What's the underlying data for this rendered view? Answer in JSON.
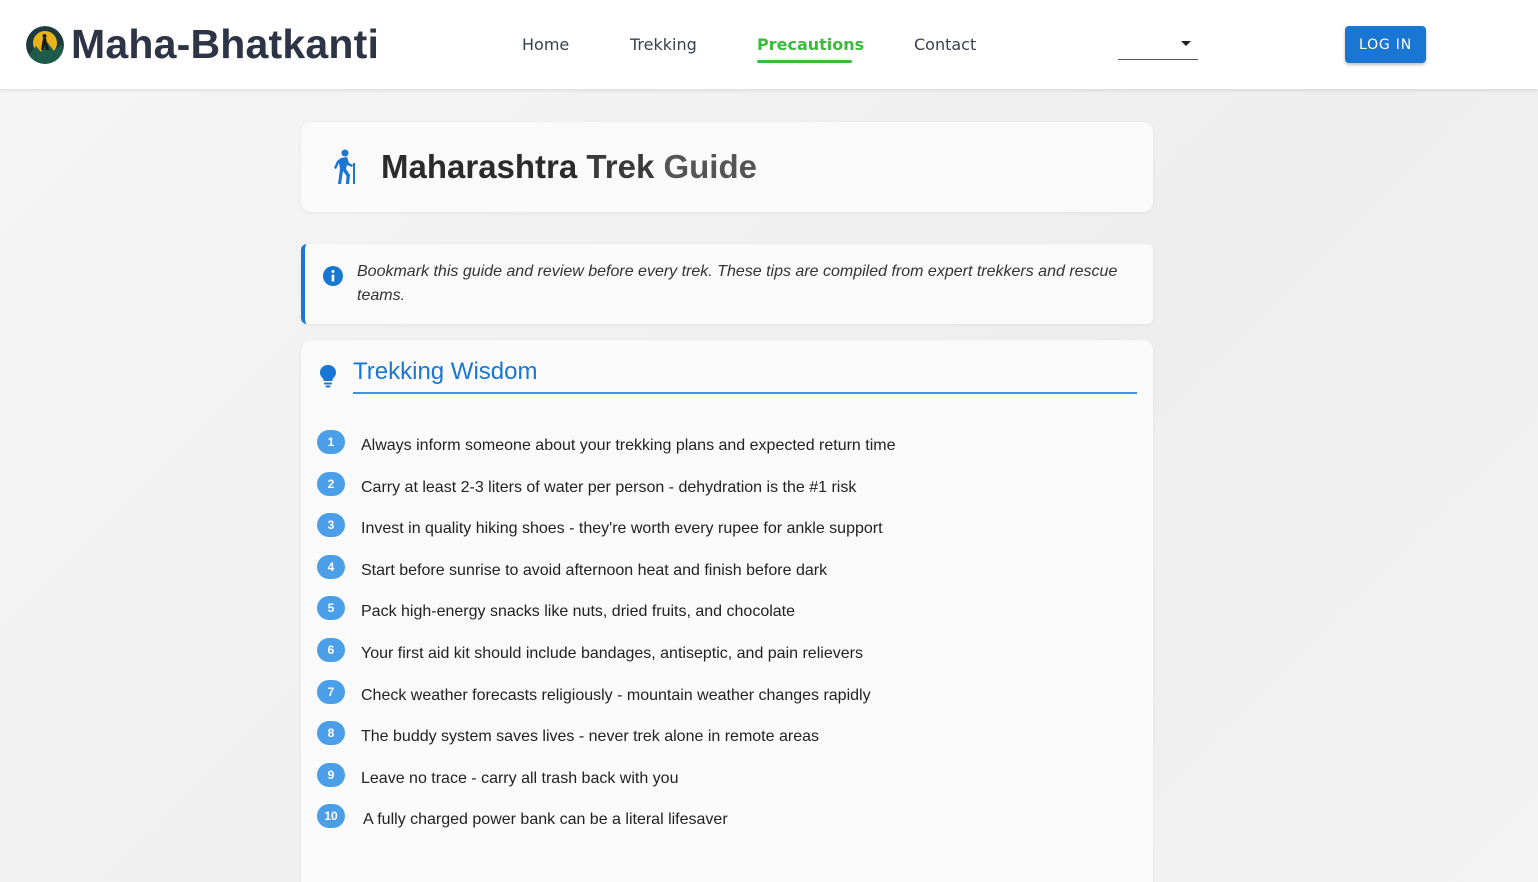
{
  "header": {
    "brand": "Maha-Bhatkanti",
    "logo_icon": "trekker-logo-icon",
    "nav": [
      {
        "label": "Home",
        "active": false
      },
      {
        "label": "Trekking",
        "active": false
      },
      {
        "label": "Precautions",
        "active": true
      },
      {
        "label": "Contact",
        "active": false
      }
    ],
    "language_select_value": "",
    "login_label": "LOG IN",
    "accent_color": "#3dba3c",
    "primary_color": "#1976d2"
  },
  "title_card": {
    "icon": "hiker-icon",
    "title_part1": "Maharashtra",
    "title_part2": "Trek",
    "title_part3": "Guide"
  },
  "info": {
    "icon": "info-icon",
    "text": "Bookmark this guide and review before every trek. These tips are compiled from expert trekkers and rescue teams."
  },
  "wisdom": {
    "icon": "lightbulb-icon",
    "title": "Trekking Wisdom",
    "tips": [
      {
        "num": "1",
        "text": "Always inform someone about your trekking plans and expected return time"
      },
      {
        "num": "2",
        "text": "Carry at least 2-3 liters of water per person - dehydration is the #1 risk"
      },
      {
        "num": "3",
        "text": "Invest in quality hiking shoes - they're worth every rupee for ankle support"
      },
      {
        "num": "4",
        "text": "Start before sunrise to avoid afternoon heat and finish before dark"
      },
      {
        "num": "5",
        "text": "Pack high-energy snacks like nuts, dried fruits, and chocolate"
      },
      {
        "num": "6",
        "text": "Your first aid kit should include bandages, antiseptic, and pain relievers"
      },
      {
        "num": "7",
        "text": "Check weather forecasts religiously - mountain weather changes rapidly"
      },
      {
        "num": "8",
        "text": "The buddy system saves lives - never trek alone in remote areas"
      },
      {
        "num": "9",
        "text": "Leave no trace - carry all trash back with you"
      },
      {
        "num": "10",
        "text": "A fully charged power bank can be a literal lifesaver"
      }
    ]
  }
}
